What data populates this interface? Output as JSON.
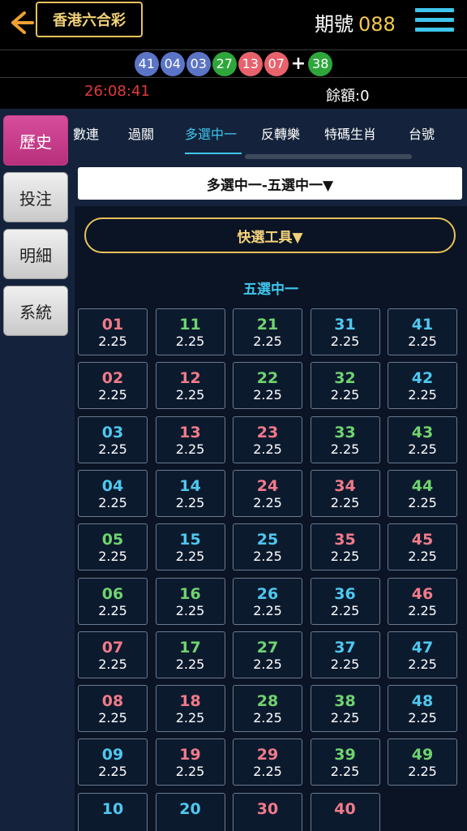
{
  "header": {
    "title": "香港六合彩",
    "period_label": "期號",
    "period_number": "088"
  },
  "draw": {
    "balls": [
      {
        "num": "41",
        "color": "blue"
      },
      {
        "num": "04",
        "color": "blue"
      },
      {
        "num": "03",
        "color": "blue"
      },
      {
        "num": "27",
        "color": "green"
      },
      {
        "num": "13",
        "color": "red"
      },
      {
        "num": "07",
        "color": "red"
      }
    ],
    "plus": "+",
    "special": {
      "num": "38",
      "color": "green"
    }
  },
  "status": {
    "countdown": "26:08:41",
    "balance": "餘額:0"
  },
  "sidebar": {
    "items": [
      "歷史",
      "投注",
      "明細",
      "系統"
    ]
  },
  "tabs": [
    "數連",
    "過關",
    "多選中一",
    "反轉樂",
    "特碼生肖",
    "台號"
  ],
  "dropdown": "多選中一-五選中一▼",
  "quick_tool": "快選工具▼",
  "section_title": "五選中一",
  "cells": [
    {
      "n": "01",
      "o": "2.25",
      "c": "red"
    },
    {
      "n": "11",
      "o": "2.25",
      "c": "green"
    },
    {
      "n": "21",
      "o": "2.25",
      "c": "green"
    },
    {
      "n": "31",
      "o": "2.25",
      "c": "blue"
    },
    {
      "n": "41",
      "o": "2.25",
      "c": "blue"
    },
    {
      "n": "02",
      "o": "2.25",
      "c": "red"
    },
    {
      "n": "12",
      "o": "2.25",
      "c": "red"
    },
    {
      "n": "22",
      "o": "2.25",
      "c": "green"
    },
    {
      "n": "32",
      "o": "2.25",
      "c": "green"
    },
    {
      "n": "42",
      "o": "2.25",
      "c": "blue"
    },
    {
      "n": "03",
      "o": "2.25",
      "c": "blue"
    },
    {
      "n": "13",
      "o": "2.25",
      "c": "red"
    },
    {
      "n": "23",
      "o": "2.25",
      "c": "red"
    },
    {
      "n": "33",
      "o": "2.25",
      "c": "green"
    },
    {
      "n": "43",
      "o": "2.25",
      "c": "green"
    },
    {
      "n": "04",
      "o": "2.25",
      "c": "blue"
    },
    {
      "n": "14",
      "o": "2.25",
      "c": "blue"
    },
    {
      "n": "24",
      "o": "2.25",
      "c": "red"
    },
    {
      "n": "34",
      "o": "2.25",
      "c": "red"
    },
    {
      "n": "44",
      "o": "2.25",
      "c": "green"
    },
    {
      "n": "05",
      "o": "2.25",
      "c": "green"
    },
    {
      "n": "15",
      "o": "2.25",
      "c": "blue"
    },
    {
      "n": "25",
      "o": "2.25",
      "c": "blue"
    },
    {
      "n": "35",
      "o": "2.25",
      "c": "red"
    },
    {
      "n": "45",
      "o": "2.25",
      "c": "red"
    },
    {
      "n": "06",
      "o": "2.25",
      "c": "green"
    },
    {
      "n": "16",
      "o": "2.25",
      "c": "green"
    },
    {
      "n": "26",
      "o": "2.25",
      "c": "blue"
    },
    {
      "n": "36",
      "o": "2.25",
      "c": "blue"
    },
    {
      "n": "46",
      "o": "2.25",
      "c": "red"
    },
    {
      "n": "07",
      "o": "2.25",
      "c": "red"
    },
    {
      "n": "17",
      "o": "2.25",
      "c": "green"
    },
    {
      "n": "27",
      "o": "2.25",
      "c": "green"
    },
    {
      "n": "37",
      "o": "2.25",
      "c": "blue"
    },
    {
      "n": "47",
      "o": "2.25",
      "c": "blue"
    },
    {
      "n": "08",
      "o": "2.25",
      "c": "red"
    },
    {
      "n": "18",
      "o": "2.25",
      "c": "red"
    },
    {
      "n": "28",
      "o": "2.25",
      "c": "green"
    },
    {
      "n": "38",
      "o": "2.25",
      "c": "green"
    },
    {
      "n": "48",
      "o": "2.25",
      "c": "blue"
    },
    {
      "n": "09",
      "o": "2.25",
      "c": "blue"
    },
    {
      "n": "19",
      "o": "2.25",
      "c": "red"
    },
    {
      "n": "29",
      "o": "2.25",
      "c": "red"
    },
    {
      "n": "39",
      "o": "2.25",
      "c": "green"
    },
    {
      "n": "49",
      "o": "2.25",
      "c": "green"
    },
    {
      "n": "10",
      "o": "",
      "c": "blue"
    },
    {
      "n": "20",
      "o": "",
      "c": "blue"
    },
    {
      "n": "30",
      "o": "",
      "c": "red"
    },
    {
      "n": "40",
      "o": "",
      "c": "red"
    }
  ],
  "colors": {
    "accent": "#3ec6ec",
    "gold": "#e8c25a",
    "active_side": "#c33b8c",
    "timer": "#e03a3a"
  }
}
